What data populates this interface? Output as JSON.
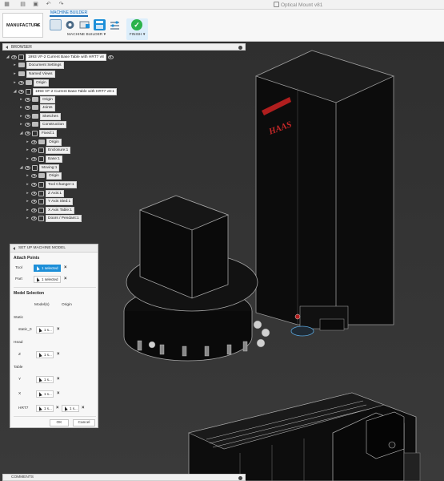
{
  "title_bar": {
    "document_title": "Optical Mount v81",
    "undo_icon": "undo-icon",
    "redo_icon": "redo-icon"
  },
  "ribbon": {
    "workspace_label": "MANUFACTURE",
    "active_tab": "MACHINE BUILDER",
    "group_label": "MACHINE BUILDER ▾",
    "finish_label": "FINISH ▾",
    "accent_color": "#1d6fb8",
    "finish_color": "#2bb34c"
  },
  "browser": {
    "header": "BROWSER",
    "items": [
      {
        "label": "1993 VF-2 Current Base Table with HRT7 v8"
      },
      {
        "label": "Document Settings"
      },
      {
        "label": "Named Views"
      },
      {
        "label": "Origin"
      },
      {
        "label": "1993 VF-2 Current Base Table with HRT7 v8:1"
      },
      {
        "label": "Origin"
      },
      {
        "label": "Joints"
      },
      {
        "label": "Sketches"
      },
      {
        "label": "Construction"
      },
      {
        "label": "Fixed:1"
      },
      {
        "label": "Origin"
      },
      {
        "label": "Enclosure:1"
      },
      {
        "label": "Base:1"
      },
      {
        "label": "Moving:1"
      },
      {
        "label": "Origin"
      },
      {
        "label": "Tool Changer:1"
      },
      {
        "label": "Z Axis:1"
      },
      {
        "label": "Y Axis Sled:1"
      },
      {
        "label": "X Axis Table:1"
      },
      {
        "label": "Doors / Pendant:1"
      }
    ]
  },
  "dialog": {
    "title": "SET UP MACHINE MODEL",
    "attach_points": "Attach Points",
    "tool_label": "Tool",
    "tool_value": "1 selected",
    "part_label": "Part",
    "part_value": "1 selected",
    "model_selection": "Model Selection",
    "col_models": "Model(s)",
    "col_origin": "Origin",
    "static_label": "Static",
    "static_item": "static_0",
    "static_value": "1 s...",
    "head_label": "Head",
    "z_label": "Z",
    "z_value": "1 s...",
    "table_label": "Table",
    "y_label": "Y",
    "y_value": "1 s...",
    "x_label": "X",
    "x_value": "1 s...",
    "hrt7_label": "HRT7",
    "hrt7_value": "1 s...",
    "hrt7_origin": "1 s...",
    "ok_label": "OK",
    "cancel_label": "Cancel"
  },
  "comments": {
    "label": "COMMENTS"
  },
  "scene": {
    "brand_logo_text": "HAAS"
  }
}
